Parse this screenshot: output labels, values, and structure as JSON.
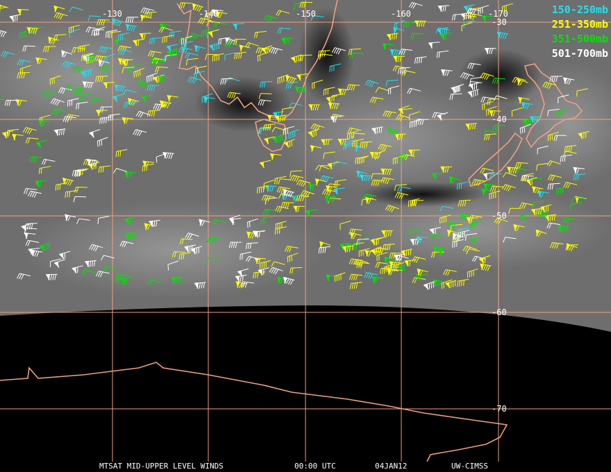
{
  "legend": [
    {
      "label": "150-250mb",
      "color": "#22e0ee"
    },
    {
      "label": "251-350mb",
      "color": "#ffff00"
    },
    {
      "label": "351-500mb",
      "color": "#00e600"
    },
    {
      "label": "501-700mb",
      "color": "#ffffff"
    }
  ],
  "grid": {
    "longitudes": [
      "-130",
      "-140",
      "-150",
      "-160",
      "-170"
    ],
    "latitudes": [
      "-30",
      "-40",
      "-50",
      "-60",
      "-70"
    ],
    "color": "#f0a080"
  },
  "coastline_color": "#f0a080",
  "footer": {
    "title": "MTSAT MID-UPPER LEVEL WINDS",
    "time": "00:00 UTC",
    "date": "04JAN12",
    "source": "UW-CIMSS"
  }
}
